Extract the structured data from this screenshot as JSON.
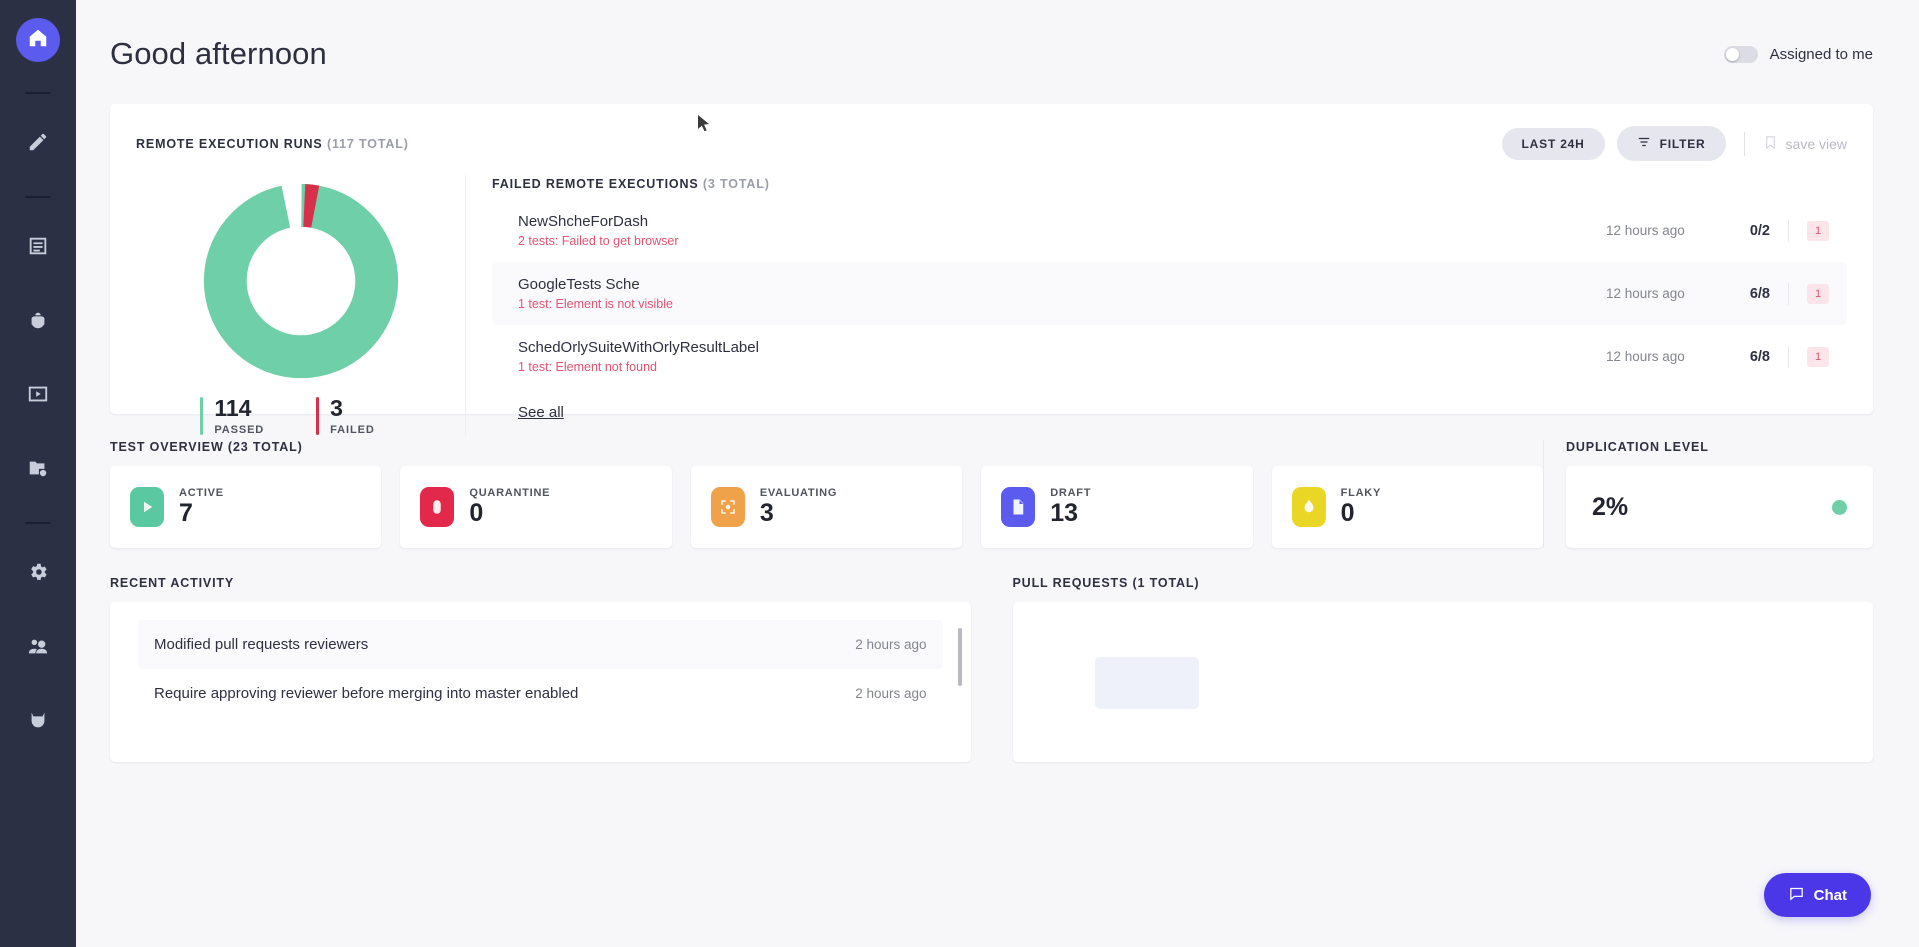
{
  "sidebar": {
    "items": [
      {
        "name": "home",
        "icon": "home-icon",
        "active": true
      },
      {
        "name": "editor",
        "icon": "pencil-icon",
        "active": false
      },
      {
        "name": "reports",
        "icon": "document-list-icon",
        "active": false
      },
      {
        "name": "bugs",
        "icon": "bug-icon",
        "active": false
      },
      {
        "name": "runs",
        "icon": "video-play-icon",
        "active": false
      },
      {
        "name": "projects",
        "icon": "folder-settings-icon",
        "active": false
      },
      {
        "name": "settings",
        "icon": "gear-icon",
        "active": false
      },
      {
        "name": "users",
        "icon": "users-icon",
        "active": false
      },
      {
        "name": "integrations",
        "icon": "cat-mask-icon",
        "active": false
      }
    ]
  },
  "header": {
    "greeting": "Good afternoon",
    "assigned_toggle_label": "Assigned to me",
    "assigned_toggle_on": false
  },
  "execution": {
    "title": "REMOTE EXECUTION RUNS",
    "total": "(117 TOTAL)",
    "range_button": "LAST 24H",
    "filter_button": "FILTER",
    "save_view": "save view",
    "donut": {
      "passed_label": "PASSED",
      "passed_value": "114",
      "failed_label": "FAILED",
      "failed_value": "3",
      "passed_color": "#6fcfa9",
      "failed_color": "#d8304a"
    },
    "failed_title": "FAILED REMOTE EXECUTIONS",
    "failed_total": "(3 TOTAL)",
    "see_all": "See all",
    "rows": [
      {
        "name": "NewShcheForDash",
        "error": "2 tests: Failed to get browser",
        "time": "12 hours ago",
        "ratio": "0/2",
        "badge": "1"
      },
      {
        "name": "GoogleTests Sche",
        "error": "1 test: Element is not visible",
        "time": "12 hours ago",
        "ratio": "6/8",
        "badge": "1"
      },
      {
        "name": "SchedOrlySuiteWithOrlyResultLabel",
        "error": "1 test: Element not found",
        "time": "12 hours ago",
        "ratio": "6/8",
        "badge": "1"
      }
    ]
  },
  "overview": {
    "title": "TEST OVERVIEW (23 TOTAL)",
    "cards": [
      {
        "label": "ACTIVE",
        "value": "7",
        "color": "#5ac8a0",
        "icon": "play-icon"
      },
      {
        "label": "QUARANTINE",
        "value": "0",
        "color": "#e2294b",
        "icon": "mouse-icon"
      },
      {
        "label": "EVALUATING",
        "value": "3",
        "color": "#efa24a",
        "icon": "scan-icon"
      },
      {
        "label": "DRAFT",
        "value": "13",
        "color": "#5b5bf0",
        "icon": "file-icon"
      },
      {
        "label": "FLAKY",
        "value": "0",
        "color": "#ead725",
        "icon": "flame-icon"
      }
    ],
    "duplication_title": "DUPLICATION LEVEL",
    "duplication_value": "2%",
    "duplication_color": "#6fcfa9"
  },
  "activity": {
    "title": "RECENT ACTIVITY",
    "rows": [
      {
        "text": "Modified pull requests reviewers",
        "time": "2 hours ago"
      },
      {
        "text": "Require approving reviewer before merging into master enabled",
        "time": "2 hours ago"
      }
    ]
  },
  "pull_requests": {
    "title": "PULL REQUESTS (1 TOTAL)"
  },
  "chat": {
    "label": "Chat",
    "color": "#4b37e8"
  },
  "chart_data": {
    "type": "pie",
    "title": "Remote execution runs",
    "categories": [
      "Passed",
      "Failed"
    ],
    "values": [
      114,
      3
    ],
    "colors": [
      "#6fcfa9",
      "#d8304a"
    ],
    "total": 117,
    "donut": true,
    "legend": "bottom"
  }
}
